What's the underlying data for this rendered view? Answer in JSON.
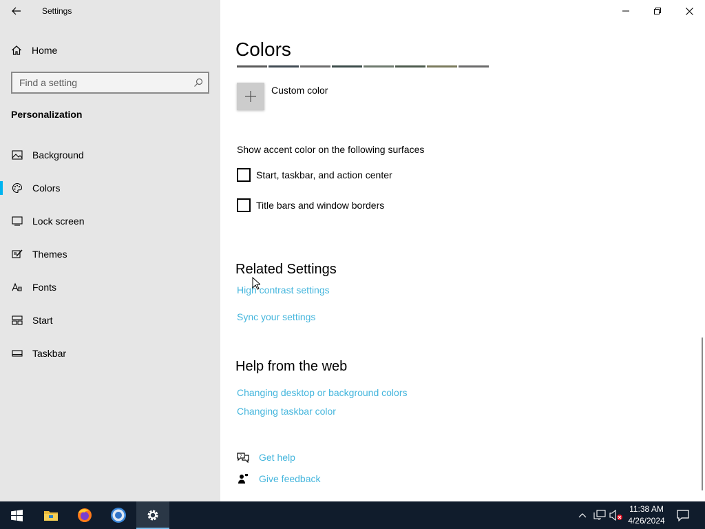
{
  "window": {
    "title": "Settings",
    "controls": [
      "minimize-icon",
      "restore-icon",
      "close-icon"
    ]
  },
  "sidebar": {
    "home_label": "Home",
    "search_placeholder": "Find a setting",
    "section_title": "Personalization",
    "items": [
      {
        "label": "Background",
        "icon": "picture-icon"
      },
      {
        "label": "Colors",
        "icon": "palette-icon",
        "active": true
      },
      {
        "label": "Lock screen",
        "icon": "lock-screen-icon"
      },
      {
        "label": "Themes",
        "icon": "brush-icon"
      },
      {
        "label": "Fonts",
        "icon": "font-icon"
      },
      {
        "label": "Start",
        "icon": "start-tiles-icon"
      },
      {
        "label": "Taskbar",
        "icon": "taskbar-icon"
      }
    ],
    "accent_color": "#00b4f0"
  },
  "main": {
    "title": "Colors",
    "swatch_colors": [
      "#5a5a5a",
      "#404a52",
      "#6b6b6b",
      "#3a4a48",
      "#6e7a6e",
      "#4c5a4c",
      "#7a7a5c",
      "#6a6a6a"
    ],
    "custom_color_label": "Custom color",
    "surfaces_title": "Show accent color on the following surfaces",
    "checkboxes": [
      {
        "label": "Start, taskbar, and action center",
        "checked": false
      },
      {
        "label": "Title bars and window borders",
        "checked": false
      }
    ],
    "related_title": "Related Settings",
    "related_links": [
      "High contrast settings",
      "Sync your settings"
    ],
    "help_title": "Help from the web",
    "help_links": [
      "Changing desktop or background colors",
      "Changing taskbar color"
    ],
    "get_help_label": "Get help",
    "give_feedback_label": "Give feedback",
    "link_color": "#45b6dd"
  },
  "taskbar": {
    "apps": [
      "windows-start-icon",
      "file-explorer-icon",
      "firefox-icon",
      "chrome-icon",
      "settings-gear-icon"
    ],
    "active_app": "settings-gear-icon",
    "tray": [
      "chevron-up-icon",
      "network-icon",
      "volume-muted-icon",
      "notification-icon"
    ],
    "time": "11:38 AM",
    "date": "4/26/2024"
  }
}
